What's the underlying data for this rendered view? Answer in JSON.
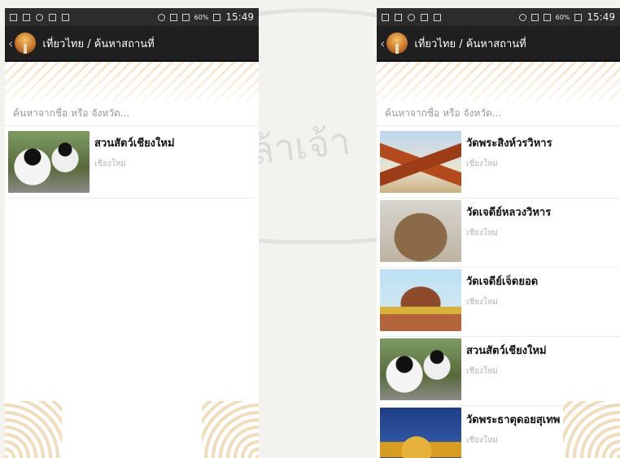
{
  "screens": {
    "left": {
      "status_time": "15:49",
      "battery_percent": "60%",
      "header_title": "เที่ยวไทย / ค้นหาสถานที่",
      "search_placeholder": "ค้นหาจากชื่อ หรือ จังหวัด...",
      "items": [
        {
          "title": "สวนสัตว์เชียงใหม่",
          "subtitle": "เชียงใหม่",
          "thumb_icon": "panda-photo"
        }
      ]
    },
    "right": {
      "status_time": "15:49",
      "battery_percent": "60%",
      "header_title": "เที่ยวไทย / ค้นหาสถานที่",
      "search_placeholder": "ค้นหาจากชื่อ หรือ จังหวัด...",
      "items": [
        {
          "title": "วัดพระสิงห์วรวิหาร",
          "subtitle": "เชียงใหม่",
          "thumb_icon": "temple-photo"
        },
        {
          "title": "วัดเจดีย์หลวงวิหาร",
          "subtitle": "เชียงใหม่",
          "thumb_icon": "chedi-ruin-photo"
        },
        {
          "title": "วัดเจดีย์เจ็ดยอด",
          "subtitle": "เชียงใหม่",
          "thumb_icon": "chedi-photo"
        },
        {
          "title": "สวนสัตว์เชียงใหม่",
          "subtitle": "เชียงใหม่",
          "thumb_icon": "panda-photo"
        },
        {
          "title": "วัดพระธาตุดอยสุเทพ",
          "subtitle": "เชียงใหม่",
          "thumb_icon": "golden-pagoda-photo"
        }
      ]
    }
  },
  "watermark_text": "จอมเกล้าเจ้า",
  "colors": {
    "header_bg": "#1f1f1f",
    "statusbar_bg": "#2c2c2c",
    "ornament": "#d6a046"
  }
}
